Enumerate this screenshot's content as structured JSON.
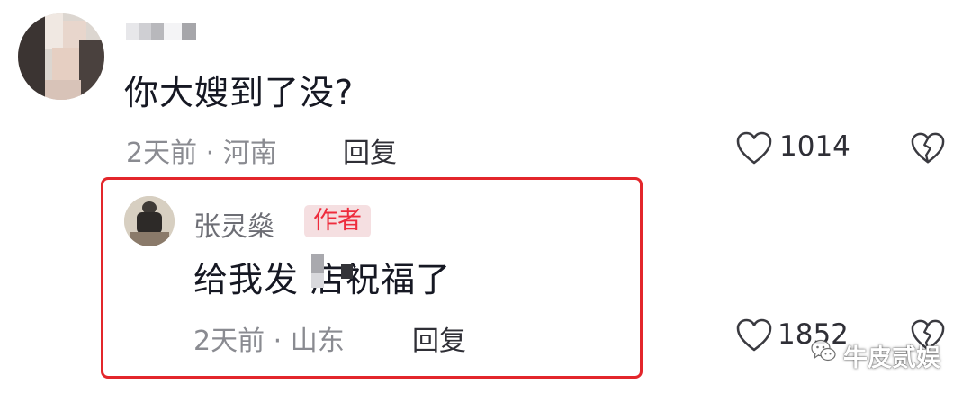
{
  "comment": {
    "text": "你大嫂到了没?",
    "meta": "2天前 · 河南",
    "reply_label": "回复",
    "likes": "1014"
  },
  "reply": {
    "author": "张灵燊",
    "badge": "作者",
    "text": "给我发  店祝福了",
    "meta": "2天前 · 山东",
    "reply_label": "回复",
    "likes": "1852"
  },
  "watermark": {
    "text": "牛皮贰娱"
  },
  "colors": {
    "highlight_border": "#e3262b",
    "badge_bg": "#f5dfe1",
    "badge_text": "#ee2c3d",
    "meta_text": "#8a8b91"
  },
  "icons": [
    "heart-icon",
    "broken-heart-icon",
    "wechat-icon"
  ]
}
